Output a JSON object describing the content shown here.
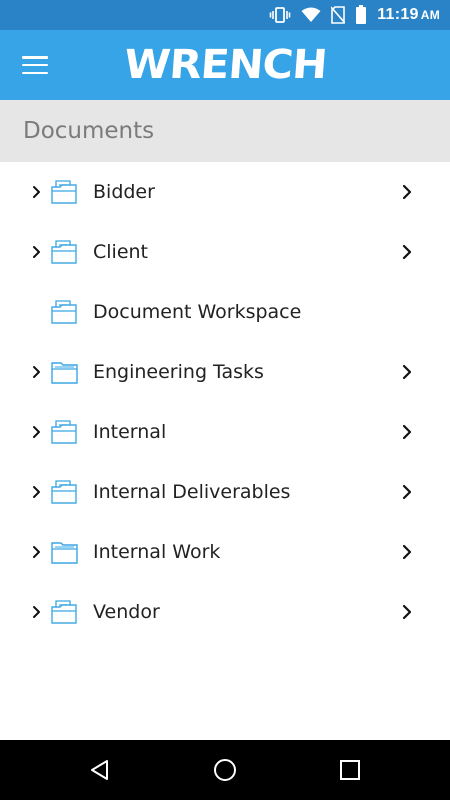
{
  "status_bar": {
    "time": "11:19",
    "ampm": "AM",
    "icons": [
      "vibrate-icon",
      "wifi-icon",
      "no-sim-icon",
      "battery-icon"
    ]
  },
  "app_bar": {
    "menu_icon": "hamburger-menu-icon",
    "logo_text": "WRENCH"
  },
  "section": {
    "title": "Documents"
  },
  "documents": [
    {
      "label": "Bidder",
      "icon": "document-folder-icon",
      "expandable": true
    },
    {
      "label": "Client",
      "icon": "document-folder-icon",
      "expandable": true
    },
    {
      "label": "Document Workspace",
      "icon": "document-folder-icon",
      "expandable": false
    },
    {
      "label": "Engineering Tasks",
      "icon": "open-folder-icon",
      "expandable": true
    },
    {
      "label": "Internal",
      "icon": "document-folder-icon",
      "expandable": true
    },
    {
      "label": "Internal Deliverables",
      "icon": "document-folder-icon",
      "expandable": true
    },
    {
      "label": "Internal Work",
      "icon": "open-folder-icon",
      "expandable": true
    },
    {
      "label": "Vendor",
      "icon": "document-folder-icon",
      "expandable": true
    }
  ],
  "nav_bar": {
    "buttons": [
      "back-icon",
      "home-icon",
      "recents-icon"
    ]
  },
  "colors": {
    "status_bar": "#2a83c7",
    "app_bar": "#36a4e6",
    "section_header": "#e6e6e6",
    "folder_icon": "#3aa6e3",
    "nav_bar": "#000000"
  }
}
